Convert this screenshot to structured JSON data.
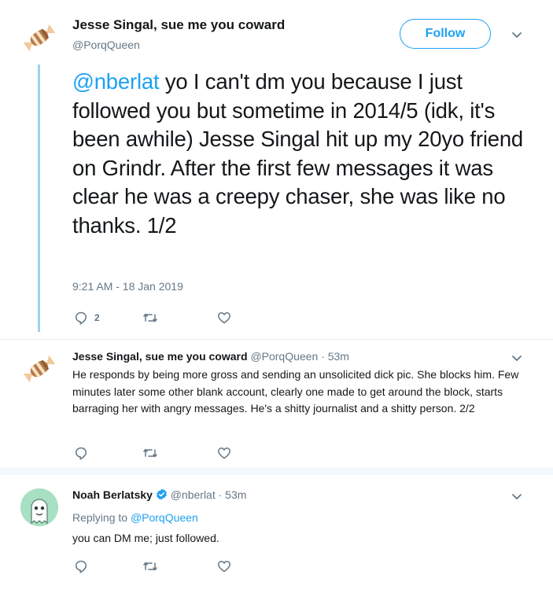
{
  "main_tweet": {
    "author_name": "Jesse Singal, sue me you coward",
    "author_handle": "@PorqQueen",
    "follow_label": "Follow",
    "text_mention": "@nberlat",
    "text_body": " yo I can't dm you because I just followed you but sometime in 2014/5 (idk, it's been awhile) Jesse Singal hit up my 20yo friend on Grindr. After the first few messages it was clear he was a creepy chaser, she was like no thanks. 1/2",
    "timestamp": "9:21 AM - 18 Jan 2019",
    "reply_count": "2"
  },
  "reply1": {
    "author_name": "Jesse Singal, sue me you coward",
    "meta": "@PorqQueen · 53m",
    "text": "He responds by being more gross and sending an unsolicited dick pic. She blocks him. Few minutes later some other blank account, clearly one made to get around the block, starts barraging her with angry messages. He's a shitty journalist and a shitty person. 2/2"
  },
  "reply2": {
    "author_name": "Noah Berlatsky",
    "meta": "@nberlat · 53m",
    "replying_prefix": "Replying to ",
    "replying_handle": "@PorqQueen",
    "text": "you can DM me; just followed."
  },
  "colors": {
    "accent": "#1da1f2",
    "thread_line": "#9cd2f0",
    "muted": "#657786"
  },
  "icons": [
    "candy-avatar",
    "ghost-avatar",
    "verified-badge-icon",
    "reply-icon",
    "retweet-icon",
    "like-icon",
    "chevron-down-icon"
  ]
}
